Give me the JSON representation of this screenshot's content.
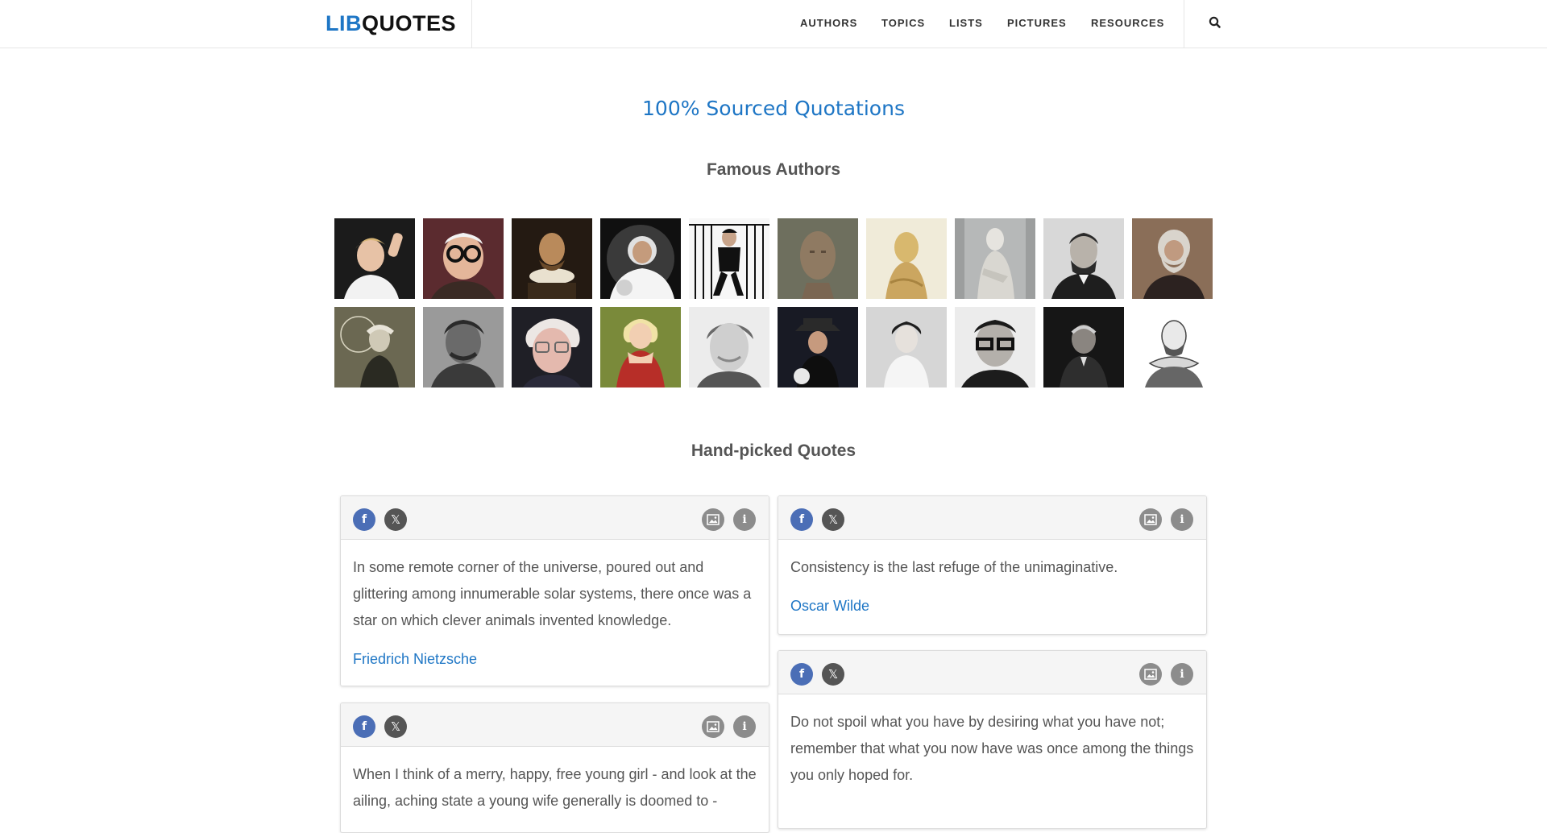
{
  "logo": {
    "part1": "LIB",
    "part2": "QUOTES"
  },
  "nav": {
    "items": [
      "AUTHORS",
      "TOPICS",
      "LISTS",
      "PICTURES",
      "RESOURCES"
    ],
    "search_icon": "search-icon"
  },
  "hero": {
    "title": "100% Sourced Quotations"
  },
  "famous_authors": {
    "heading": "Famous Authors",
    "thumbnails": [
      "author-photo",
      "author-photo",
      "author-photo",
      "author-photo",
      "author-photo",
      "author-photo",
      "author-photo",
      "author-photo",
      "author-photo",
      "author-photo",
      "author-photo",
      "author-photo",
      "author-photo",
      "author-photo",
      "author-photo",
      "author-photo",
      "author-photo",
      "author-photo",
      "author-photo",
      "author-photo"
    ]
  },
  "hand_picked": {
    "heading": "Hand-picked Quotes",
    "quotes": [
      {
        "text": "In some remote corner of the universe, poured out and glittering among innumerable solar systems, there once was a star on which clever animals invented knowledge.",
        "author": "Friedrich Nietzsche"
      },
      {
        "text": "Consistency is the last refuge of the unimaginative.",
        "author": "Oscar Wilde"
      },
      {
        "text": "When I think of a merry, happy, free young girl - and look at the ailing, aching state a young wife generally is doomed to -",
        "author": ""
      },
      {
        "text": "Do not spoil what you have by desiring what you have not; remember that what you now have was once among the things you only hoped for.",
        "author": ""
      }
    ]
  },
  "colors": {
    "brand_blue": "#1e76c5",
    "facebook": "#4b6eb6",
    "x_dark": "#555555",
    "icon_gray": "#8c8c8c"
  }
}
